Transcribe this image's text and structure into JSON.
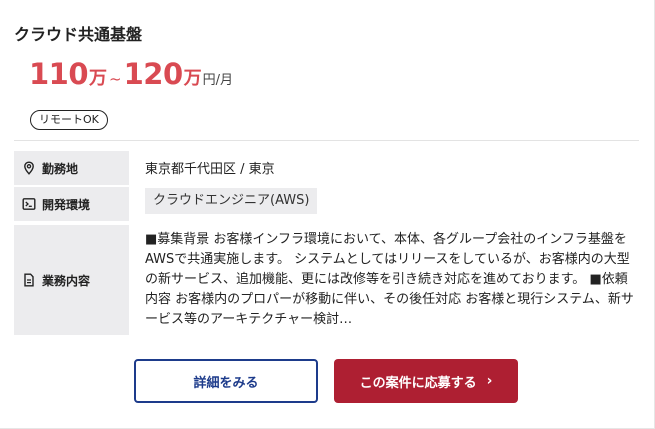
{
  "job": {
    "title": "クラウド共通基盤",
    "price": {
      "min": "110",
      "max": "120",
      "man": "万",
      "tilde": "~",
      "unit": "円/月"
    },
    "badge": "リモートOK",
    "rows": {
      "location_label": "勤務地",
      "location_value": "東京都千代田区 / 東京",
      "env_label": "開発環境",
      "env_tag": "クラウドエンジニア(AWS)",
      "desc_label": "業務内容",
      "desc_value": "■募集背景 お客様インフラ環境において、本体、各グループ会社のインフラ基盤をAWSで共通実施します。 システムとしてはリリースをしているが、お客様内の大型の新サービス、追加機能、更には改修等を引き続き対応を進めております。 ■依頼内容 お客様内のプロパーが移動に伴い、その後任対応 お客様と現行システム、新サービス等のアーキテクチャー検討…"
    }
  },
  "buttons": {
    "detail": "詳細をみる",
    "apply": "この案件に応募する",
    "apply_chevron": "›"
  },
  "icons": {
    "location": "map-pin-icon",
    "env": "terminal-icon",
    "desc": "document-icon"
  },
  "colors": {
    "price": "#d94a52",
    "label_bg": "#ececee",
    "detail_border": "#1d3b8b",
    "apply_bg": "#ae1f32"
  }
}
